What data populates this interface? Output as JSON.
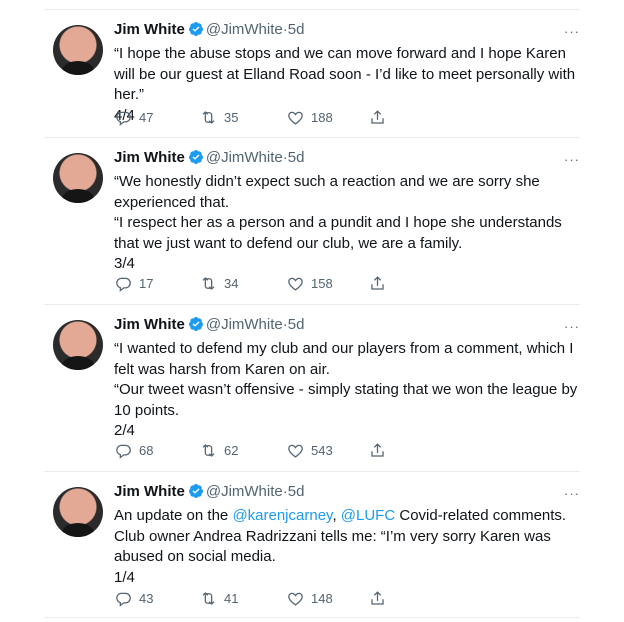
{
  "tweets": [
    {
      "author": "Jim White",
      "handle": "@JimWhite",
      "separator": "·",
      "time": "5d",
      "body_lines": [
        "“I hope the abuse stops and we can move forward and I hope Karen will be our guest at Elland Road soon - I’d like to meet personally with her.”",
        "4/4"
      ],
      "replies": "47",
      "retweets": "35",
      "likes": "188"
    },
    {
      "author": "Jim White",
      "handle": "@JimWhite",
      "separator": "·",
      "time": "5d",
      "body_lines": [
        "“We honestly didn’t expect such a reaction and we are sorry she experienced that.",
        "“I respect her as a person and a pundit and I hope she understands that we just want to defend our club, we are a family.",
        "3/4"
      ],
      "replies": "17",
      "retweets": "34",
      "likes": "158"
    },
    {
      "author": "Jim White",
      "handle": "@JimWhite",
      "separator": "·",
      "time": "5d",
      "body_lines": [
        "“I wanted to defend my club and our players from a comment, which I felt was harsh from Karen on air.",
        "“Our tweet wasn’t offensive - simply stating that we won the league by 10 points.",
        "2/4"
      ],
      "replies": "68",
      "retweets": "62",
      "likes": "543"
    },
    {
      "author": "Jim White",
      "handle": "@JimWhite",
      "separator": "·",
      "time": "5d",
      "body_intro": "An update on the",
      "mention1": "@karenjcarney",
      "comma": ",",
      "mention2": "@LUFC",
      "body_rest": "Covid-related comments. Club owner Andrea Radrizzani tells me: “I’m very sorry Karen was abused on social media.",
      "body_footer": "1/4",
      "replies": "43",
      "retweets": "41",
      "likes": "148"
    }
  ],
  "more_icon": "···",
  "icons": {
    "verified": "verified-badge-icon",
    "reply": "reply-icon",
    "retweet": "retweet-icon",
    "like": "heart-icon",
    "share": "share-icon"
  },
  "colors": {
    "accent": "#1d9bf0",
    "muted": "#536471",
    "text": "#0f1419"
  }
}
